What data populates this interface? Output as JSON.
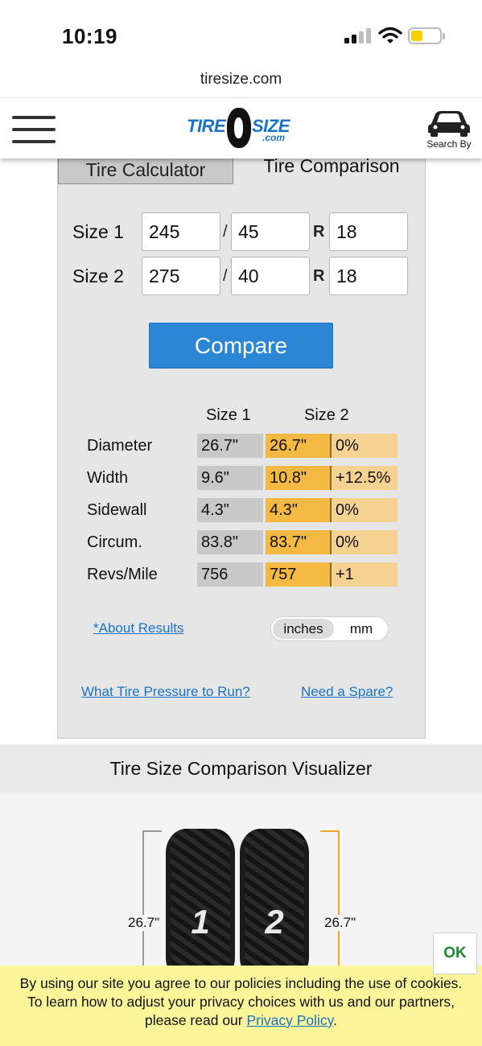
{
  "status_bar": {
    "time": "10:19"
  },
  "browser": {
    "url": "tiresize.com"
  },
  "header": {
    "logo_part1": "TIRE",
    "logo_part2": "SIZE",
    "logo_part3": ".com",
    "search_by_label": "Search By"
  },
  "tabs": {
    "calculator": "Tire Calculator",
    "comparison": "Tire Comparison"
  },
  "form": {
    "size1_label": "Size 1",
    "size2_label": "Size 2",
    "slash": "/",
    "r": "R",
    "size1": {
      "width": "245",
      "aspect": "45",
      "rim": "18"
    },
    "size2": {
      "width": "275",
      "aspect": "40",
      "rim": "18"
    },
    "compare_label": "Compare"
  },
  "results": {
    "col_size1": "Size 1",
    "col_size2": "Size 2",
    "rows": [
      {
        "label": "Diameter",
        "size1": "26.7\"",
        "size2": "26.7\"",
        "diff": "0%"
      },
      {
        "label": "Width",
        "size1": "9.6\"",
        "size2": "10.8\"",
        "diff": "+12.5%"
      },
      {
        "label": "Sidewall",
        "size1": "4.3\"",
        "size2": "4.3\"",
        "diff": "0%"
      },
      {
        "label": "Circum.",
        "size1": "83.8\"",
        "size2": "83.7\"",
        "diff": "0%"
      },
      {
        "label": "Revs/Mile",
        "size1": "756",
        "size2": "757",
        "diff": "+1"
      }
    ],
    "about_link": "*About Results",
    "unit_inches": "inches",
    "unit_mm": "mm",
    "selected_unit": "inches"
  },
  "links": {
    "pressure": "What Tire Pressure to Run?",
    "spare": "Need a Spare?"
  },
  "visualizer": {
    "title": "Tire Size Comparison Visualizer",
    "tire1_number": "1",
    "tire2_number": "2",
    "tire1_diameter": "26.7\"",
    "tire2_diameter": "26.7\""
  },
  "cookie": {
    "line1": "By using our site you agree to our policies including the use of cookies.",
    "line2": "To learn how to adjust your privacy choices with us and our partners,",
    "line3_prefix": "please read our ",
    "privacy_link": "Privacy Policy",
    "line3_suffix": ".",
    "ok_label": "OK"
  },
  "colors": {
    "link_blue": "#1a73c6",
    "compare_button": "#2b87d6",
    "size2_cell": "#f4b942",
    "diff_cell": "#f6d292",
    "size1_cell": "#c8c8c8",
    "cookie_banner": "#fbf59a",
    "ok_green": "#1d8a2c"
  }
}
